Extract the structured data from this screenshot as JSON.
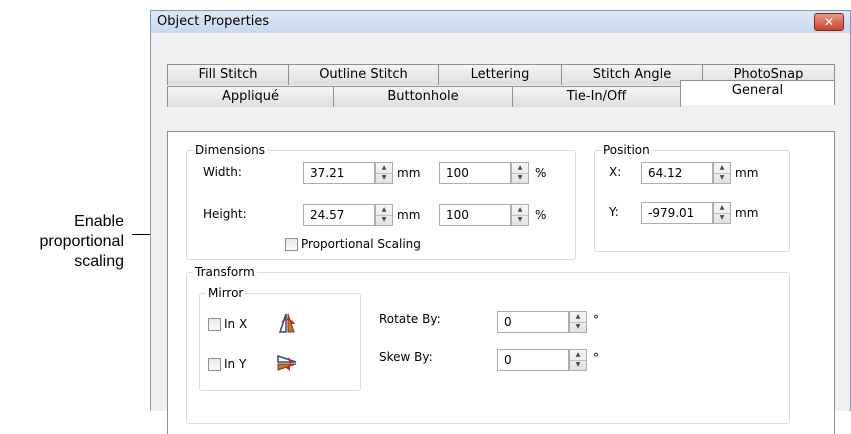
{
  "callout": {
    "lines": [
      "Enable",
      "proportional",
      "scaling"
    ]
  },
  "window": {
    "title": "Object Properties",
    "close_glyph": "✕"
  },
  "tabs": {
    "row1": [
      "Fill Stitch",
      "Outline Stitch",
      "Lettering",
      "Stitch Angle",
      "PhotoSnap"
    ],
    "row2": [
      "Appliqué",
      "Buttonhole",
      "Tie-In/Off",
      "General"
    ],
    "active": "General"
  },
  "dimensions": {
    "title": "Dimensions",
    "width": {
      "label": "Width:",
      "value": "37.21",
      "unit": "mm",
      "percent": "100",
      "percent_unit": "%"
    },
    "height": {
      "label": "Height:",
      "value": "24.57",
      "unit": "mm",
      "percent": "100",
      "percent_unit": "%"
    },
    "proportional": {
      "label": "Proportional Scaling",
      "checked": false
    }
  },
  "position": {
    "title": "Position",
    "x": {
      "label": "X:",
      "value": "64.12",
      "unit": "mm"
    },
    "y": {
      "label": "Y:",
      "value": "-979.01",
      "unit": "mm"
    }
  },
  "transform": {
    "title": "Transform",
    "mirror": {
      "title": "Mirror",
      "in_x": "In X",
      "in_y": "In Y"
    },
    "rotate": {
      "label": "Rotate By:",
      "value": "0",
      "unit": "°"
    },
    "skew": {
      "label": "Skew By:",
      "value": "0",
      "unit": "°"
    }
  },
  "icons": [
    "mirror-x-icon",
    "mirror-y-icon",
    "spin-up-icon",
    "spin-down-icon",
    "close-icon"
  ]
}
